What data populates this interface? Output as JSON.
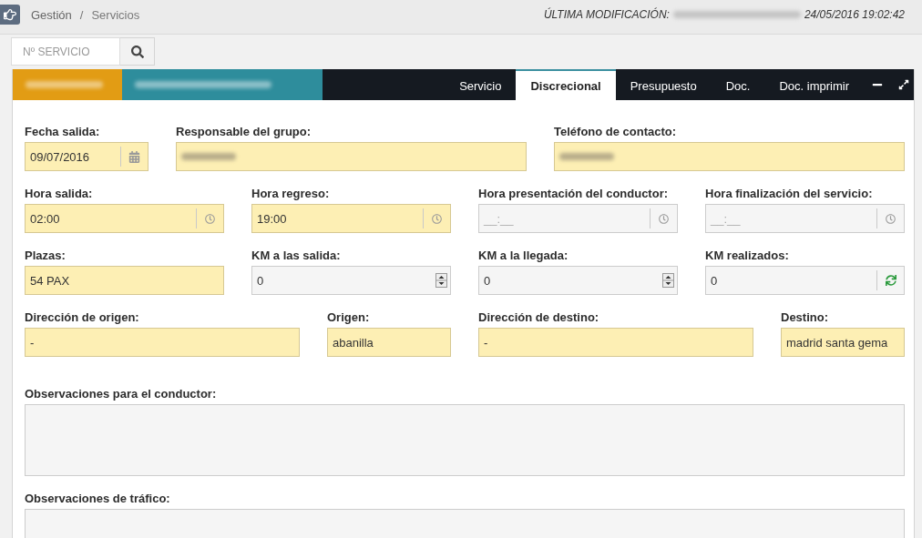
{
  "topbar": {
    "breadcrumb": {
      "items": [
        "Gestión",
        "Servicios"
      ],
      "separator": "/"
    },
    "last_modified": {
      "label": "ÚLTIMA MODIFICACIÓN:",
      "user_redacted": true,
      "date": "24/05/2016 19:02:42"
    }
  },
  "search": {
    "placeholder": "Nº SERVICIO"
  },
  "panel": {
    "tags": [
      {
        "color": "#e29c14"
      },
      {
        "color": "#2e8d9c"
      }
    ],
    "tabs": [
      {
        "label": "Servicio",
        "selected": false
      },
      {
        "label": "Discrecional",
        "selected": true
      },
      {
        "label": "Presupuesto",
        "selected": false
      },
      {
        "label": "Doc.",
        "selected": false
      },
      {
        "label": "Doc. imprimir",
        "selected": false
      }
    ]
  },
  "form": {
    "rows": [
      {
        "fields": [
          {
            "label": "Fecha salida:",
            "kind": "date",
            "highlighted": true,
            "value": "09/07/2016"
          },
          {
            "label": "Responsable del grupo:",
            "kind": "text",
            "highlighted": true,
            "redacted": true
          },
          {
            "label": "Teléfono de contacto:",
            "kind": "text",
            "highlighted": true,
            "redacted": true
          }
        ]
      },
      {
        "fields": [
          {
            "label": "Hora salida:",
            "kind": "time",
            "highlighted": true,
            "value": "02:00"
          },
          {
            "label": "Hora regreso:",
            "kind": "time",
            "highlighted": true,
            "value": "19:00"
          },
          {
            "label": "Hora presentación del conductor:",
            "kind": "time",
            "highlighted": false,
            "placeholder": "__:__"
          },
          {
            "label": "Hora finalización del servicio:",
            "kind": "time",
            "highlighted": false,
            "placeholder": "__:__"
          }
        ]
      },
      {
        "fields": [
          {
            "label": "Plazas:",
            "kind": "text",
            "highlighted": true,
            "value": "54 PAX"
          },
          {
            "label": "KM a las salida:",
            "kind": "number",
            "highlighted": false,
            "value": "0"
          },
          {
            "label": "KM a la llegada:",
            "kind": "number",
            "highlighted": false,
            "value": "0"
          },
          {
            "label": "KM realizados:",
            "kind": "computed",
            "highlighted": false,
            "value": "0"
          }
        ]
      },
      {
        "fields": [
          {
            "label": "Dirección de origen:",
            "kind": "text",
            "highlighted": true,
            "value": "-"
          },
          {
            "label": "Origen:",
            "kind": "text",
            "highlighted": true,
            "value": "abanilla"
          },
          {
            "label": "Dirección de destino:",
            "kind": "text",
            "highlighted": true,
            "value": "-"
          },
          {
            "label": "Destino:",
            "kind": "text",
            "highlighted": true,
            "value": "madrid santa gema"
          }
        ]
      },
      {
        "fields": [
          {
            "label": "Observaciones para el conductor:",
            "kind": "textarea",
            "highlighted": false
          }
        ]
      },
      {
        "fields": [
          {
            "label": "Observaciones de tráfico:",
            "kind": "textarea",
            "highlighted": false
          }
        ]
      }
    ]
  }
}
